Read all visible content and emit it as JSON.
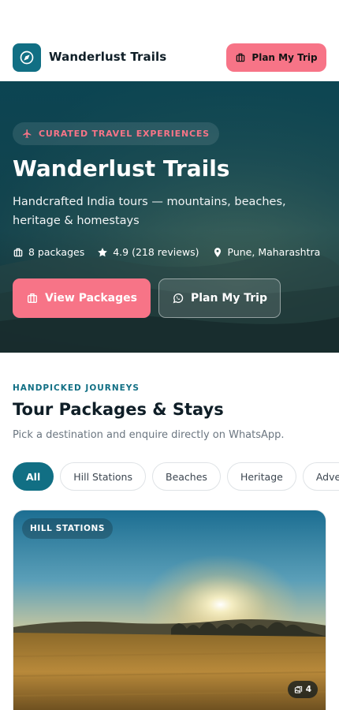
{
  "header": {
    "brand": "Wanderlust Trails",
    "plan_button": "Plan My Trip",
    "logo_icon": "compass-icon"
  },
  "hero": {
    "badge": "CURATED TRAVEL EXPERIENCES",
    "title": "Wanderlust Trails",
    "subtitle": "Handcrafted India tours — mountains, beaches, heritage & homestays",
    "meta": {
      "packages": "8 packages",
      "rating": "4.9 (218 reviews)",
      "location": "Pune, Maharashtra"
    },
    "view_button": "View Packages",
    "plan_button": "Plan My Trip"
  },
  "section": {
    "eyebrow": "HANDPICKED JOURNEYS",
    "title": "Tour Packages & Stays",
    "subtitle": "Pick a destination and enquire directly on WhatsApp."
  },
  "filters": [
    "All",
    "Hill Stations",
    "Beaches",
    "Heritage",
    "Adventure"
  ],
  "active_filter": "All",
  "card": {
    "tag": "HILL STATIONS",
    "photo_count": "4"
  },
  "colors": {
    "primary": "#116f84",
    "accent": "#f77487"
  }
}
